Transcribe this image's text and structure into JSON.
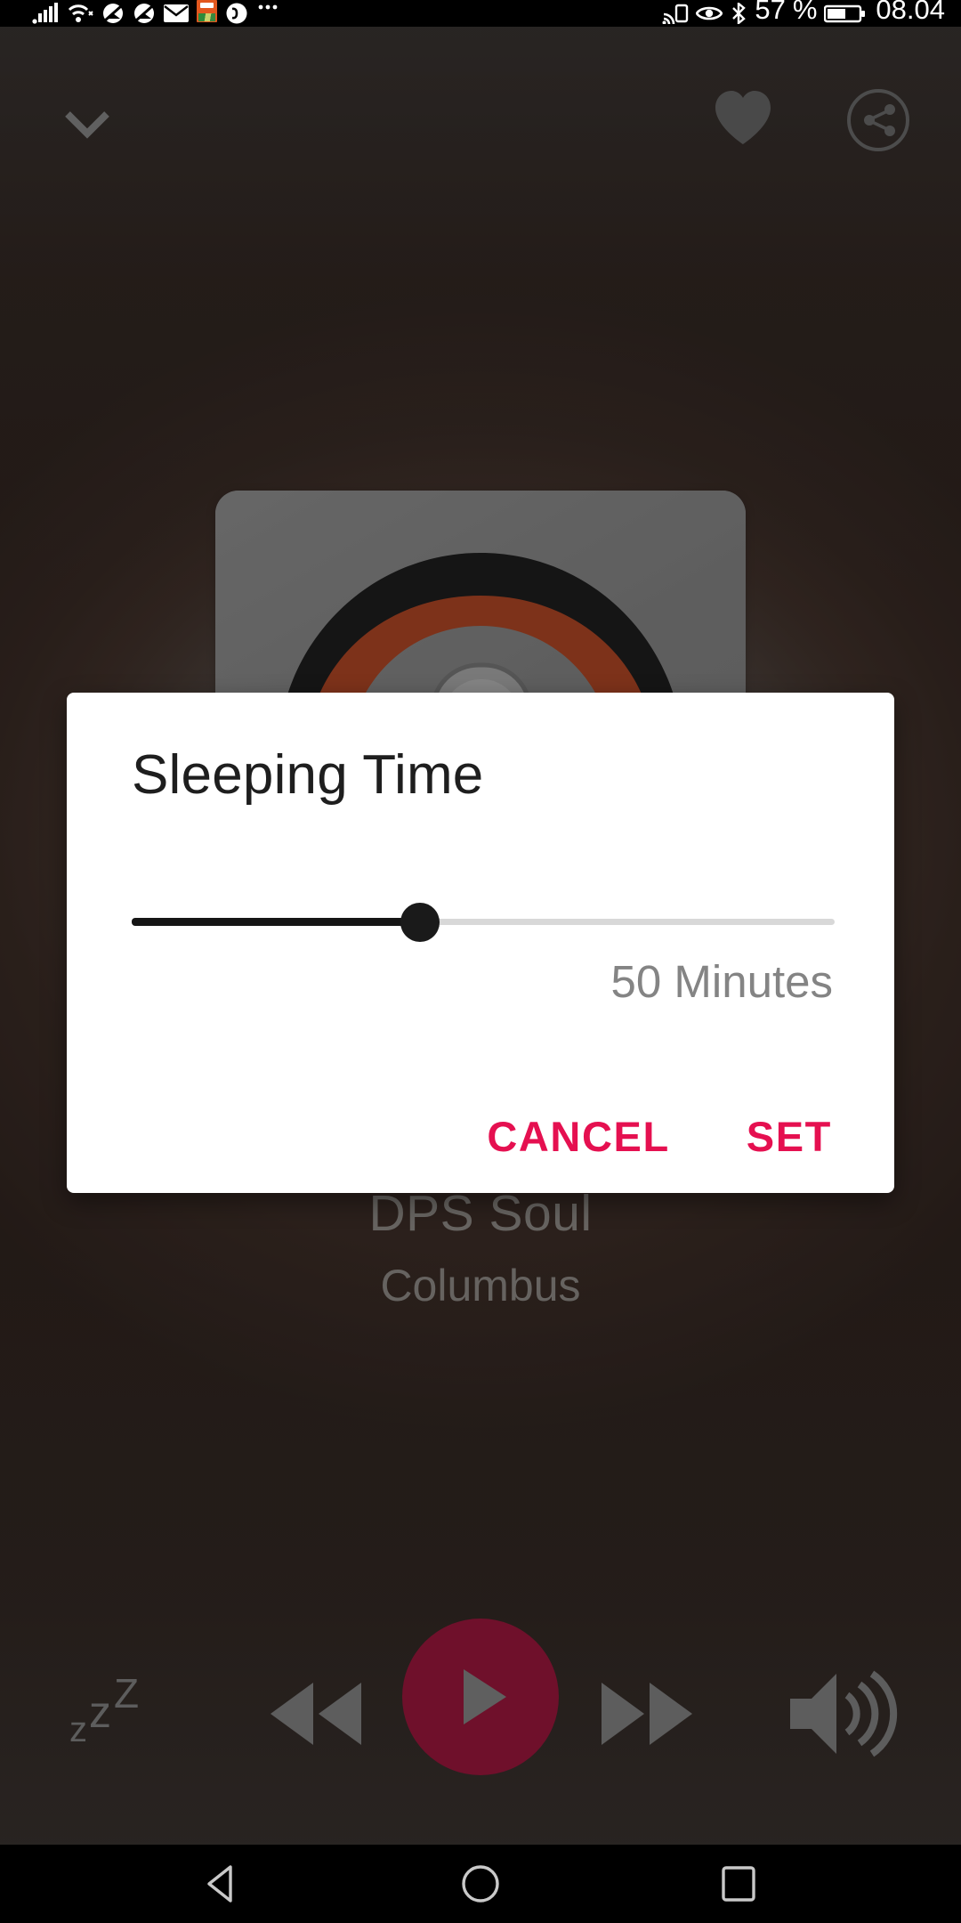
{
  "status_bar": {
    "battery_percent": "57",
    "percent_symbol": "%",
    "clock": "08.04",
    "left_icons": [
      "signal-bars-icon",
      "wifi-icon",
      "ringer-muted-icon",
      "vibrate-muted-icon",
      "email-icon",
      "app-icon",
      "phone-icon",
      "more-icons"
    ],
    "right_icons": [
      "cast-icon",
      "eye-icon",
      "bluetooth-icon",
      "battery-icon"
    ]
  },
  "player": {
    "collapse_icon": "chevron-down-icon",
    "favorite_icon": "heart-icon",
    "share_icon": "share-icon",
    "album_art": "radio-microphone-logo",
    "station_name": "DPS Soul",
    "station_city": "Columbus",
    "controls": {
      "sleep_label": "sleep-timer-icon",
      "rewind_label": "rewind-icon",
      "play_label": "play-icon",
      "forward_label": "fast-forward-icon",
      "volume_label": "volume-icon",
      "play_button_color": "#a80b38"
    }
  },
  "dialog": {
    "title": "Sleeping Time",
    "slider": {
      "value": 50,
      "min": 0,
      "max": 120,
      "fill_percent": 41
    },
    "value_label": "50 Minutes",
    "cancel_label": "CANCEL",
    "set_label": "SET",
    "accent_color": "#e51050"
  },
  "nav_bar": {
    "back_icon": "back-triangle-icon",
    "home_icon": "home-circle-icon",
    "recents_icon": "recents-square-icon"
  }
}
